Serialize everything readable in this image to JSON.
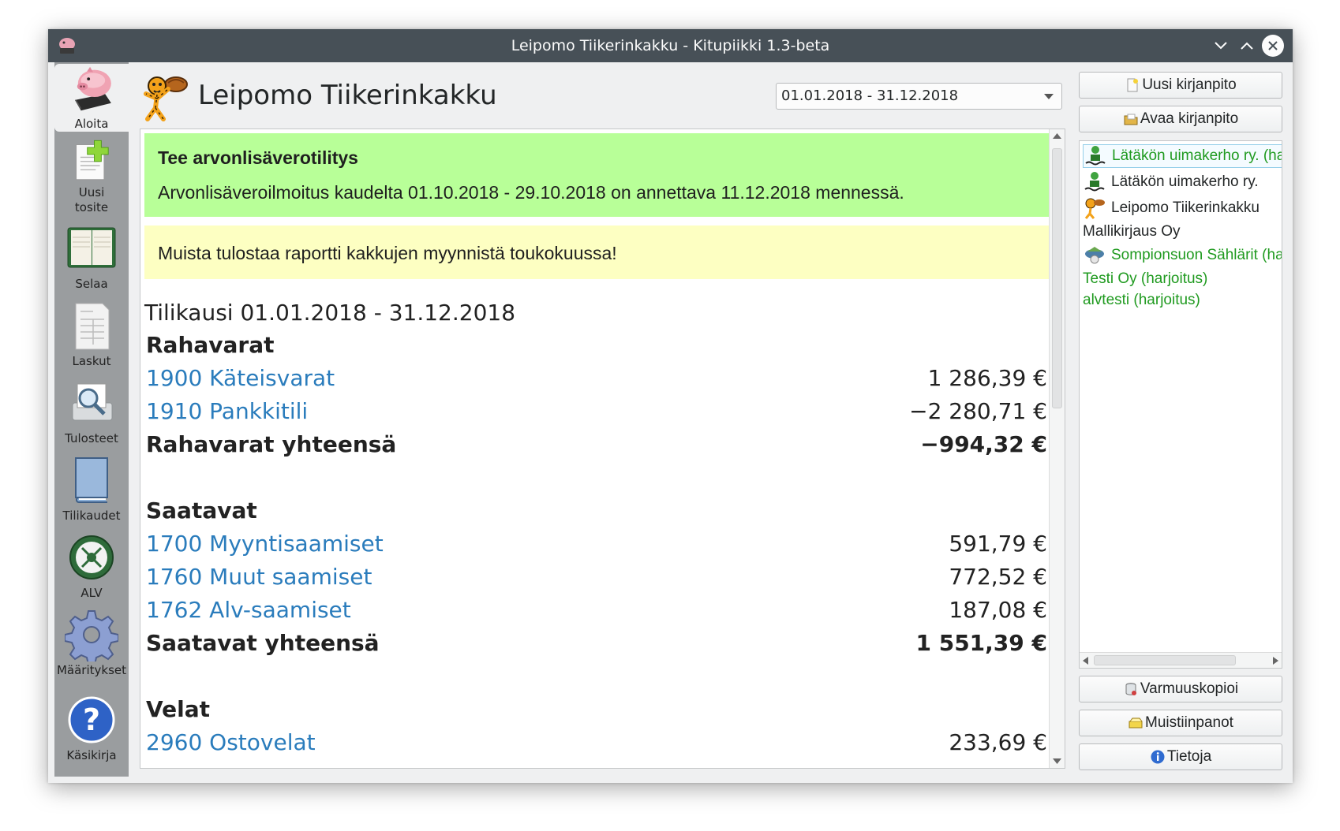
{
  "window": {
    "title": "Leipomo Tiikerinkakku - Kitupiikki 1.3-beta"
  },
  "sidebar": {
    "items": [
      {
        "label": "Aloita",
        "icon": "piggy-bank-icon",
        "active": true
      },
      {
        "label": "Uusi\ntosite",
        "icon": "new-document-icon"
      },
      {
        "label": "Selaa",
        "icon": "ledger-book-icon"
      },
      {
        "label": "Laskut",
        "icon": "invoice-icon"
      },
      {
        "label": "Tulosteet",
        "icon": "print-preview-icon"
      },
      {
        "label": "Tilikaudet",
        "icon": "book-icon"
      },
      {
        "label": "ALV",
        "icon": "tax-emblem-icon"
      },
      {
        "label": "Määritykset",
        "icon": "gear-icon"
      },
      {
        "label": "Käsikirja",
        "icon": "help-icon"
      }
    ]
  },
  "header": {
    "company": "Leipomo Tiikerinkakku",
    "period": "01.01.2018 - 31.12.2018"
  },
  "notices": {
    "vat_title": "Tee arvonlisäverotilitys",
    "vat_text": "Arvonlisäveroilmoitus kaudelta 01.10.2018 - 29.10.2018 on annettava 11.12.2018 mennessä.",
    "reminder": "Muista tulostaa raportti kakkujen myynnistä toukokuussa!"
  },
  "report": {
    "period_heading": "Tilikausi 01.01.2018 - 31.12.2018",
    "rows": [
      {
        "type": "head",
        "name": "Rahavarat",
        "value": ""
      },
      {
        "type": "link",
        "name": "1900 Käteisvarat",
        "value": "1 286,39 €"
      },
      {
        "type": "link",
        "name": "1910 Pankkitili",
        "value": "−2 280,71 €"
      },
      {
        "type": "total",
        "name": "Rahavarat yhteensä",
        "value": "−994,32 €"
      },
      {
        "type": "spacer",
        "name": "",
        "value": ""
      },
      {
        "type": "head",
        "name": "Saatavat",
        "value": ""
      },
      {
        "type": "link",
        "name": "1700 Myyntisaamiset",
        "value": "591,79 €"
      },
      {
        "type": "link",
        "name": "1760 Muut saamiset",
        "value": "772,52 €"
      },
      {
        "type": "link",
        "name": "1762 Alv-saamiset",
        "value": "187,08 €"
      },
      {
        "type": "total",
        "name": "Saatavat yhteensä",
        "value": "1 551,39 €"
      },
      {
        "type": "spacer",
        "name": "",
        "value": ""
      },
      {
        "type": "head",
        "name": "Velat",
        "value": ""
      },
      {
        "type": "link",
        "name": "2960 Ostovelat",
        "value": "233,69 €"
      }
    ]
  },
  "right_panel": {
    "new_bookkeeping": "Uusi kirjanpito",
    "open_bookkeeping": "Avaa kirjanpito",
    "recent": [
      {
        "label": "Lätäkön uimakerho ry. (harjoitus)",
        "color": "green",
        "icon": "swimmer-icon",
        "selected": true
      },
      {
        "label": "Lätäkön uimakerho ry.",
        "color": "black",
        "icon": "swimmer-icon"
      },
      {
        "label": "Leipomo Tiikerinkakku",
        "color": "black",
        "icon": "tiger-logo-icon"
      },
      {
        "label": "Mallikirjaus Oy",
        "color": "black",
        "icon": ""
      },
      {
        "label": "Sompionsuon Sählärit (harjoitus)",
        "color": "green",
        "icon": "bird-icon"
      },
      {
        "label": "Testi Oy (harjoitus)",
        "color": "green",
        "icon": ""
      },
      {
        "label": "alvtesti (harjoitus)",
        "color": "green",
        "icon": ""
      }
    ],
    "backup": "Varmuuskopioi",
    "notes": "Muistiinpanot",
    "info": "Tietoja"
  },
  "colors": {
    "titlebar": "#475057",
    "sidebar": "#9a9d9f",
    "link": "#2a7cbc",
    "notice_green": "#b8ff98",
    "notice_yellow": "#fdffc2",
    "recent_green": "#1f9a1f"
  }
}
